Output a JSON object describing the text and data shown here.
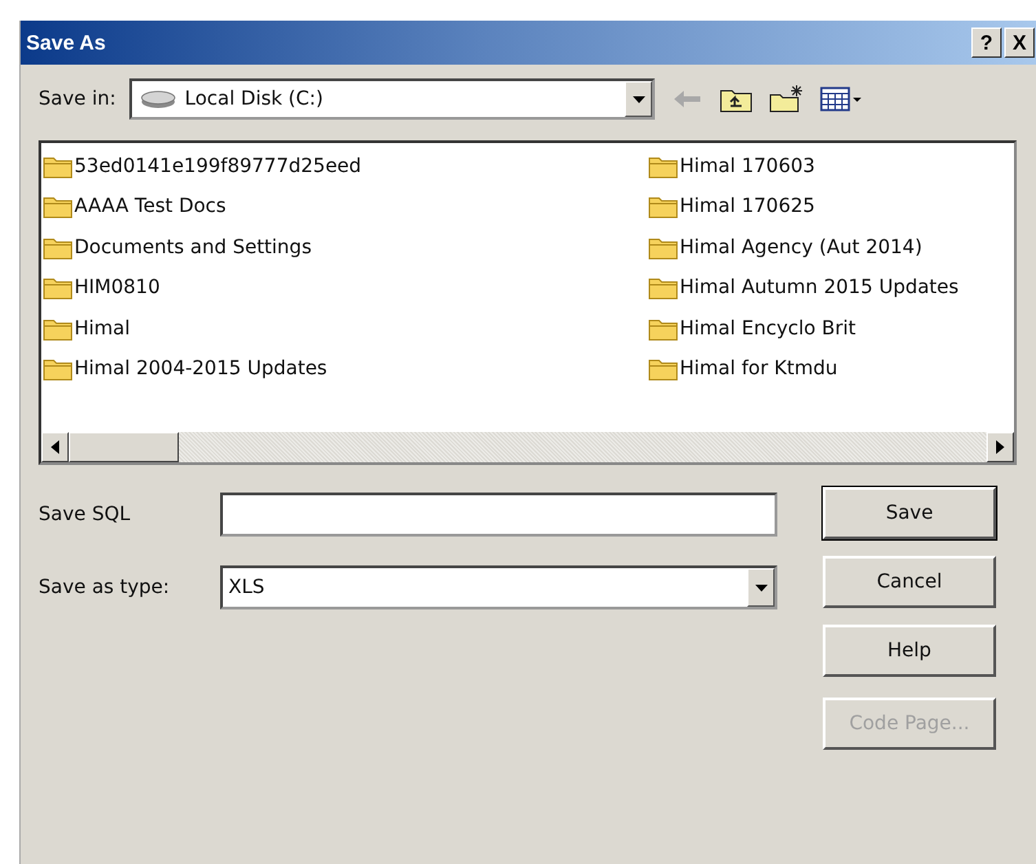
{
  "window": {
    "title": "Save As",
    "help": "?",
    "close": "X"
  },
  "save_in": {
    "label": "Save in:",
    "value": "Local Disk (C:)"
  },
  "folders": [
    {
      "name": "53ed0141e199f89777d25eed"
    },
    {
      "name": "AAAA Test Docs"
    },
    {
      "name": "Documents and Settings"
    },
    {
      "name": "HIM0810"
    },
    {
      "name": "Himal"
    },
    {
      "name": "Himal 2004-2015 Updates"
    },
    {
      "name": "Himal 170603"
    },
    {
      "name": "Himal 170625"
    },
    {
      "name": "Himal Agency (Aut 2014)"
    },
    {
      "name": "Himal Autumn 2015 Updates"
    },
    {
      "name": "Himal Encyclo Brit"
    },
    {
      "name": "Himal for Ktmdu"
    }
  ],
  "file_name": {
    "label": "Save SQL"
  },
  "file_type": {
    "label": "Save as type:",
    "value": "XLS"
  },
  "buttons": [
    {
      "label": "Save",
      "default": true,
      "disabled": false
    },
    {
      "label": "Cancel",
      "default": false,
      "disabled": false
    },
    {
      "label": "Help",
      "default": false,
      "disabled": false
    },
    {
      "label": "Code Page...",
      "default": false,
      "disabled": true
    }
  ]
}
